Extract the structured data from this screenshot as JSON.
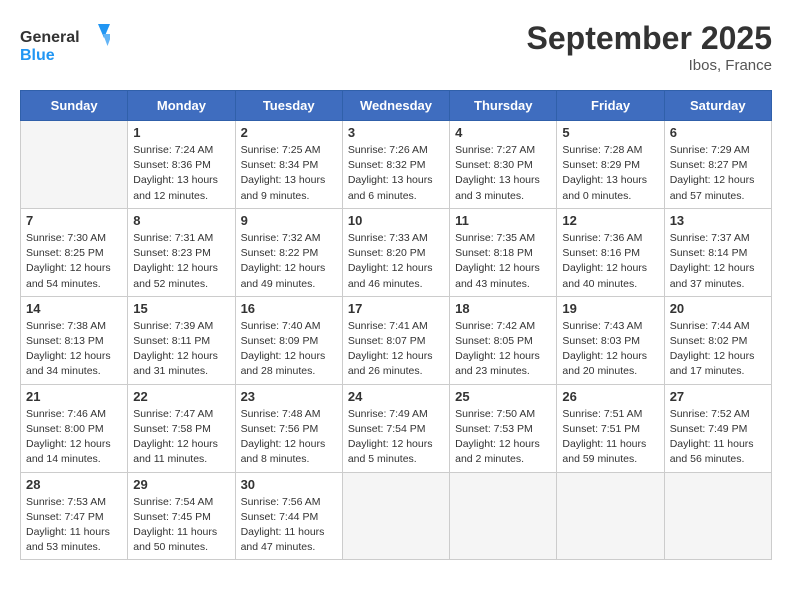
{
  "logo": {
    "line1": "General",
    "line2": "Blue"
  },
  "title": "September 2025",
  "location": "Ibos, France",
  "days_of_week": [
    "Sunday",
    "Monday",
    "Tuesday",
    "Wednesday",
    "Thursday",
    "Friday",
    "Saturday"
  ],
  "weeks": [
    [
      {
        "day": "",
        "sunrise": "",
        "sunset": "",
        "daylight": ""
      },
      {
        "day": "1",
        "sunrise": "Sunrise: 7:24 AM",
        "sunset": "Sunset: 8:36 PM",
        "daylight": "Daylight: 13 hours and 12 minutes."
      },
      {
        "day": "2",
        "sunrise": "Sunrise: 7:25 AM",
        "sunset": "Sunset: 8:34 PM",
        "daylight": "Daylight: 13 hours and 9 minutes."
      },
      {
        "day": "3",
        "sunrise": "Sunrise: 7:26 AM",
        "sunset": "Sunset: 8:32 PM",
        "daylight": "Daylight: 13 hours and 6 minutes."
      },
      {
        "day": "4",
        "sunrise": "Sunrise: 7:27 AM",
        "sunset": "Sunset: 8:30 PM",
        "daylight": "Daylight: 13 hours and 3 minutes."
      },
      {
        "day": "5",
        "sunrise": "Sunrise: 7:28 AM",
        "sunset": "Sunset: 8:29 PM",
        "daylight": "Daylight: 13 hours and 0 minutes."
      },
      {
        "day": "6",
        "sunrise": "Sunrise: 7:29 AM",
        "sunset": "Sunset: 8:27 PM",
        "daylight": "Daylight: 12 hours and 57 minutes."
      }
    ],
    [
      {
        "day": "7",
        "sunrise": "Sunrise: 7:30 AM",
        "sunset": "Sunset: 8:25 PM",
        "daylight": "Daylight: 12 hours and 54 minutes."
      },
      {
        "day": "8",
        "sunrise": "Sunrise: 7:31 AM",
        "sunset": "Sunset: 8:23 PM",
        "daylight": "Daylight: 12 hours and 52 minutes."
      },
      {
        "day": "9",
        "sunrise": "Sunrise: 7:32 AM",
        "sunset": "Sunset: 8:22 PM",
        "daylight": "Daylight: 12 hours and 49 minutes."
      },
      {
        "day": "10",
        "sunrise": "Sunrise: 7:33 AM",
        "sunset": "Sunset: 8:20 PM",
        "daylight": "Daylight: 12 hours and 46 minutes."
      },
      {
        "day": "11",
        "sunrise": "Sunrise: 7:35 AM",
        "sunset": "Sunset: 8:18 PM",
        "daylight": "Daylight: 12 hours and 43 minutes."
      },
      {
        "day": "12",
        "sunrise": "Sunrise: 7:36 AM",
        "sunset": "Sunset: 8:16 PM",
        "daylight": "Daylight: 12 hours and 40 minutes."
      },
      {
        "day": "13",
        "sunrise": "Sunrise: 7:37 AM",
        "sunset": "Sunset: 8:14 PM",
        "daylight": "Daylight: 12 hours and 37 minutes."
      }
    ],
    [
      {
        "day": "14",
        "sunrise": "Sunrise: 7:38 AM",
        "sunset": "Sunset: 8:13 PM",
        "daylight": "Daylight: 12 hours and 34 minutes."
      },
      {
        "day": "15",
        "sunrise": "Sunrise: 7:39 AM",
        "sunset": "Sunset: 8:11 PM",
        "daylight": "Daylight: 12 hours and 31 minutes."
      },
      {
        "day": "16",
        "sunrise": "Sunrise: 7:40 AM",
        "sunset": "Sunset: 8:09 PM",
        "daylight": "Daylight: 12 hours and 28 minutes."
      },
      {
        "day": "17",
        "sunrise": "Sunrise: 7:41 AM",
        "sunset": "Sunset: 8:07 PM",
        "daylight": "Daylight: 12 hours and 26 minutes."
      },
      {
        "day": "18",
        "sunrise": "Sunrise: 7:42 AM",
        "sunset": "Sunset: 8:05 PM",
        "daylight": "Daylight: 12 hours and 23 minutes."
      },
      {
        "day": "19",
        "sunrise": "Sunrise: 7:43 AM",
        "sunset": "Sunset: 8:03 PM",
        "daylight": "Daylight: 12 hours and 20 minutes."
      },
      {
        "day": "20",
        "sunrise": "Sunrise: 7:44 AM",
        "sunset": "Sunset: 8:02 PM",
        "daylight": "Daylight: 12 hours and 17 minutes."
      }
    ],
    [
      {
        "day": "21",
        "sunrise": "Sunrise: 7:46 AM",
        "sunset": "Sunset: 8:00 PM",
        "daylight": "Daylight: 12 hours and 14 minutes."
      },
      {
        "day": "22",
        "sunrise": "Sunrise: 7:47 AM",
        "sunset": "Sunset: 7:58 PM",
        "daylight": "Daylight: 12 hours and 11 minutes."
      },
      {
        "day": "23",
        "sunrise": "Sunrise: 7:48 AM",
        "sunset": "Sunset: 7:56 PM",
        "daylight": "Daylight: 12 hours and 8 minutes."
      },
      {
        "day": "24",
        "sunrise": "Sunrise: 7:49 AM",
        "sunset": "Sunset: 7:54 PM",
        "daylight": "Daylight: 12 hours and 5 minutes."
      },
      {
        "day": "25",
        "sunrise": "Sunrise: 7:50 AM",
        "sunset": "Sunset: 7:53 PM",
        "daylight": "Daylight: 12 hours and 2 minutes."
      },
      {
        "day": "26",
        "sunrise": "Sunrise: 7:51 AM",
        "sunset": "Sunset: 7:51 PM",
        "daylight": "Daylight: 11 hours and 59 minutes."
      },
      {
        "day": "27",
        "sunrise": "Sunrise: 7:52 AM",
        "sunset": "Sunset: 7:49 PM",
        "daylight": "Daylight: 11 hours and 56 minutes."
      }
    ],
    [
      {
        "day": "28",
        "sunrise": "Sunrise: 7:53 AM",
        "sunset": "Sunset: 7:47 PM",
        "daylight": "Daylight: 11 hours and 53 minutes."
      },
      {
        "day": "29",
        "sunrise": "Sunrise: 7:54 AM",
        "sunset": "Sunset: 7:45 PM",
        "daylight": "Daylight: 11 hours and 50 minutes."
      },
      {
        "day": "30",
        "sunrise": "Sunrise: 7:56 AM",
        "sunset": "Sunset: 7:44 PM",
        "daylight": "Daylight: 11 hours and 47 minutes."
      },
      {
        "day": "",
        "sunrise": "",
        "sunset": "",
        "daylight": ""
      },
      {
        "day": "",
        "sunrise": "",
        "sunset": "",
        "daylight": ""
      },
      {
        "day": "",
        "sunrise": "",
        "sunset": "",
        "daylight": ""
      },
      {
        "day": "",
        "sunrise": "",
        "sunset": "",
        "daylight": ""
      }
    ]
  ]
}
